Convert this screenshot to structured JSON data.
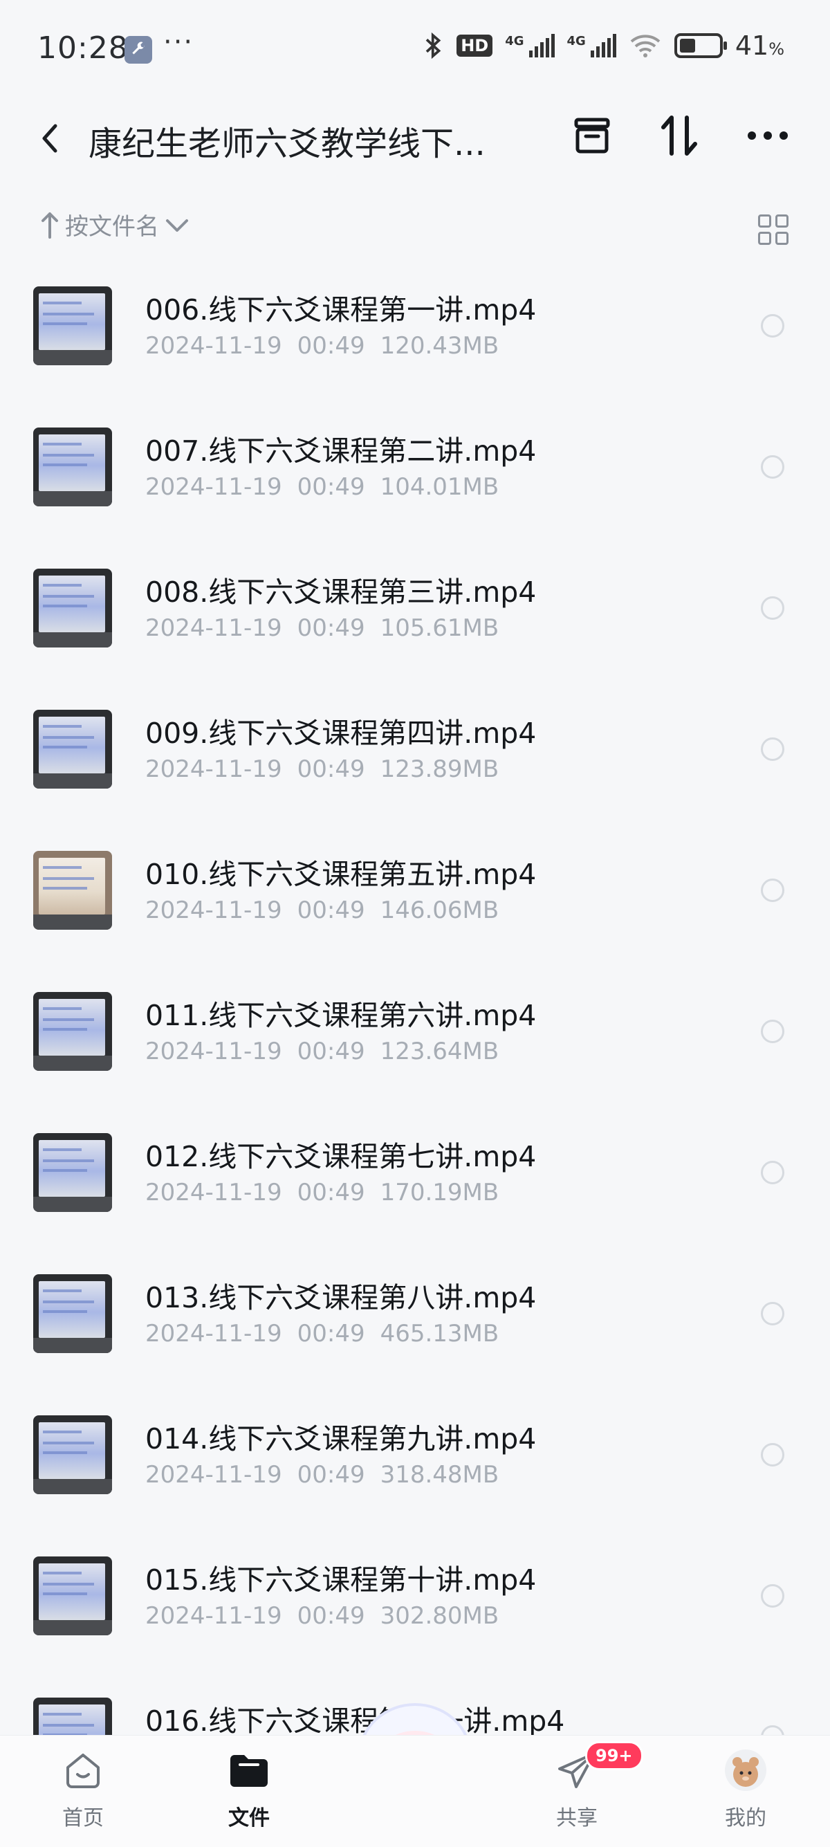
{
  "status_bar": {
    "time": "10:28",
    "more": "···",
    "hd": "HD",
    "net1": "4G",
    "net2": "4G",
    "battery_level": 0.41,
    "battery_pct": "41",
    "battery_unit": "%"
  },
  "header": {
    "title": "康纪生老师六爻教学线下..."
  },
  "sort": {
    "label": "按文件名"
  },
  "files": [
    {
      "name": "006.线下六爻课程第一讲.mp4",
      "date": "2024-11-19",
      "time": "00:49",
      "size": "120.43MB"
    },
    {
      "name": "007.线下六爻课程第二讲.mp4",
      "date": "2024-11-19",
      "time": "00:49",
      "size": "104.01MB"
    },
    {
      "name": "008.线下六爻课程第三讲.mp4",
      "date": "2024-11-19",
      "time": "00:49",
      "size": "105.61MB"
    },
    {
      "name": "009.线下六爻课程第四讲.mp4",
      "date": "2024-11-19",
      "time": "00:49",
      "size": "123.89MB"
    },
    {
      "name": "010.线下六爻课程第五讲.mp4",
      "date": "2024-11-19",
      "time": "00:49",
      "size": "146.06MB"
    },
    {
      "name": "011.线下六爻课程第六讲.mp4",
      "date": "2024-11-19",
      "time": "00:49",
      "size": "123.64MB"
    },
    {
      "name": "012.线下六爻课程第七讲.mp4",
      "date": "2024-11-19",
      "time": "00:49",
      "size": "170.19MB"
    },
    {
      "name": "013.线下六爻课程第八讲.mp4",
      "date": "2024-11-19",
      "time": "00:49",
      "size": "465.13MB"
    },
    {
      "name": "014.线下六爻课程第九讲.mp4",
      "date": "2024-11-19",
      "time": "00:49",
      "size": "318.48MB"
    },
    {
      "name": "015.线下六爻课程第十讲.mp4",
      "date": "2024-11-19",
      "time": "00:49",
      "size": "302.80MB"
    },
    {
      "name": "016.线下六爻课程第十一讲.mp4",
      "date": "",
      "time": "",
      "size": ""
    }
  ],
  "tabs": [
    {
      "label": "首页",
      "icon": "home-icon"
    },
    {
      "label": "文件",
      "icon": "folder-icon"
    },
    {
      "label": "共享",
      "icon": "paper-plane-icon",
      "badge": "99+"
    },
    {
      "label": "我的",
      "icon": "avatar"
    }
  ],
  "colors": {
    "background": "#f6f7f9",
    "text_primary": "#15181c",
    "text_secondary": "#a7adb5",
    "badge": "#ff3b5c"
  }
}
